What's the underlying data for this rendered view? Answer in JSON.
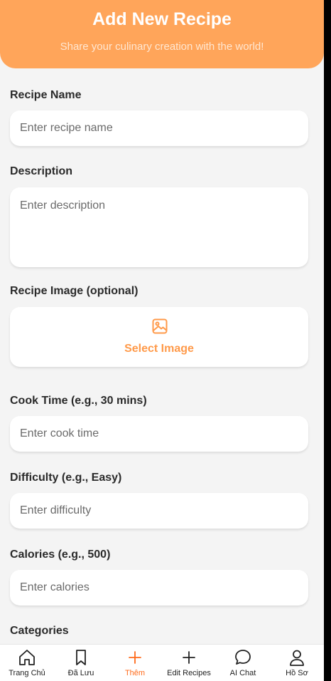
{
  "header": {
    "title": "Add New Recipe",
    "subtitle": "Share your culinary creation with the world!"
  },
  "form": {
    "recipe_name": {
      "label": "Recipe Name",
      "placeholder": "Enter recipe name"
    },
    "description": {
      "label": "Description",
      "placeholder": "Enter description"
    },
    "image": {
      "label": "Recipe Image (optional)",
      "button": "Select Image",
      "icon": "image-icon"
    },
    "cook_time": {
      "label": "Cook Time (e.g., 30 mins)",
      "placeholder": "Enter cook time"
    },
    "difficulty": {
      "label": "Difficulty (e.g., Easy)",
      "placeholder": "Enter difficulty"
    },
    "calories": {
      "label": "Calories (e.g., 500)",
      "placeholder": "Enter calories"
    },
    "categories": {
      "label": "Categories"
    }
  },
  "nav": {
    "items": [
      {
        "label": "Trang Chủ",
        "icon": "home-icon",
        "active": false
      },
      {
        "label": "Đã Lưu",
        "icon": "bookmark-icon",
        "active": false
      },
      {
        "label": "Thêm",
        "icon": "plus-icon",
        "active": true
      },
      {
        "label": "Edit Recipes",
        "icon": "plus-icon",
        "active": false
      },
      {
        "label": "AI Chat",
        "icon": "chat-bubble-icon",
        "active": false
      },
      {
        "label": "Hồ Sơ",
        "icon": "user-icon",
        "active": false
      }
    ]
  },
  "colors": {
    "accent": "#ffa55a",
    "accent_text": "#ff9a4a",
    "active_nav": "#ff6a1a",
    "background": "#f4f4f4"
  }
}
